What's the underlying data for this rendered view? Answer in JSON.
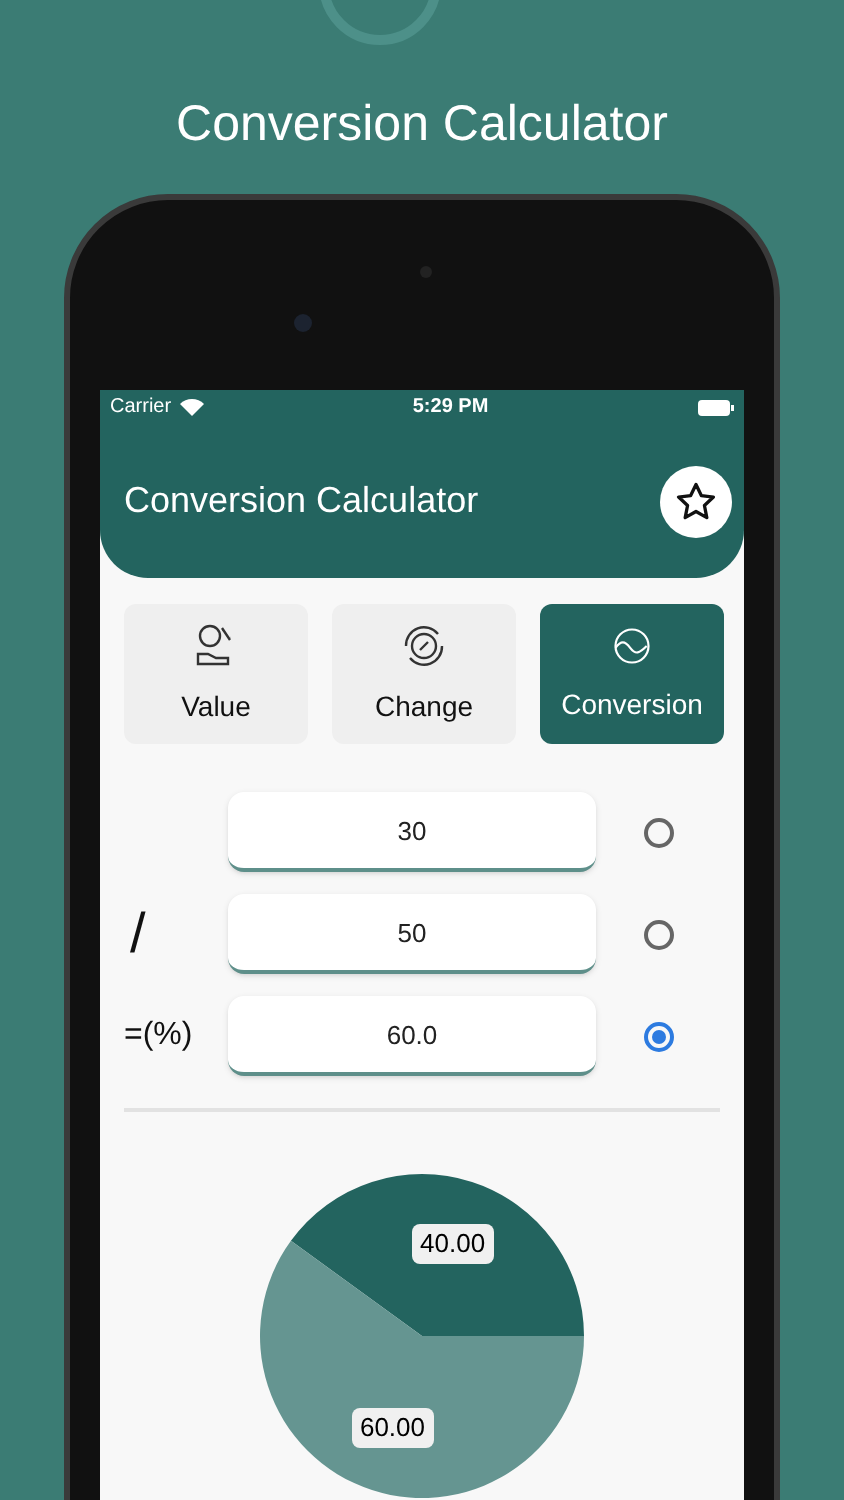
{
  "promo_title": "Conversion Calculator",
  "status_bar": {
    "carrier": "Carrier",
    "time": "5:29 PM"
  },
  "app_bar": {
    "title": "Conversion Calculator"
  },
  "tabs": [
    {
      "label": "Value",
      "kind": "value",
      "selected": false
    },
    {
      "label": "Change",
      "kind": "change",
      "selected": false
    },
    {
      "label": "Conversion",
      "kind": "conversion",
      "selected": true
    }
  ],
  "rows": [
    {
      "value": "30",
      "selected": false
    },
    {
      "operator": "/",
      "value": "50",
      "selected": false
    },
    {
      "operator": "=(%)",
      "value": "60.0",
      "selected": true
    }
  ],
  "chart_data": {
    "type": "pie",
    "values": [
      40,
      60
    ],
    "value_labels": [
      "40.00",
      "60.00"
    ]
  }
}
